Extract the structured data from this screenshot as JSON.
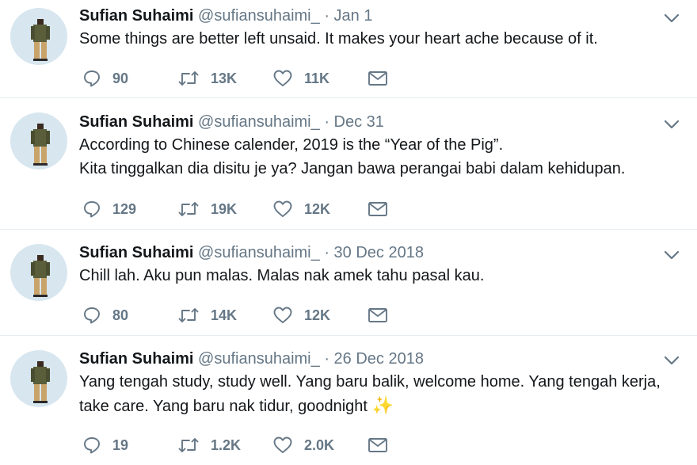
{
  "tweets": [
    {
      "name": "Sufian Suhaimi",
      "handle": "@sufiansuhaimi_",
      "separator": "·",
      "date": "Jan 1",
      "lines": [
        "Some things are better left unsaid. It makes your heart ache because of it."
      ],
      "replies": "90",
      "retweets": "13K",
      "likes": "11K"
    },
    {
      "name": "Sufian Suhaimi",
      "handle": "@sufiansuhaimi_",
      "separator": "·",
      "date": "Dec 31",
      "lines": [
        "According to Chinese calender, 2019 is the “Year of the Pig”.",
        "Kita tinggalkan dia disitu je ya? Jangan bawa perangai babi dalam kehidupan."
      ],
      "replies": "129",
      "retweets": "19K",
      "likes": "12K"
    },
    {
      "name": "Sufian Suhaimi",
      "handle": "@sufiansuhaimi_",
      "separator": "·",
      "date": "30 Dec 2018",
      "lines": [
        "Chill lah. Aku pun malas. Malas nak amek tahu pasal kau."
      ],
      "replies": "80",
      "retweets": "14K",
      "likes": "12K"
    },
    {
      "name": "Sufian Suhaimi",
      "handle": "@sufiansuhaimi_",
      "separator": "·",
      "date": "26 Dec 2018",
      "lines": [
        "Yang tengah study, study well. Yang baru balik, welcome home. Yang tengah kerja,",
        "take care. Yang baru nak tidur, goodnight"
      ],
      "emoji": "✨",
      "replies": "19",
      "retweets": "1.2K",
      "likes": "2.0K"
    }
  ],
  "icons": {
    "reply": "reply-icon",
    "retweet": "retweet-icon",
    "like": "heart-icon",
    "dm": "envelope-icon",
    "menu": "chevron-down-icon"
  },
  "colors": {
    "text": "#14171a",
    "muted": "#657786",
    "divider": "#e6ecf0",
    "avatar_bg": "#d7e6ef"
  }
}
